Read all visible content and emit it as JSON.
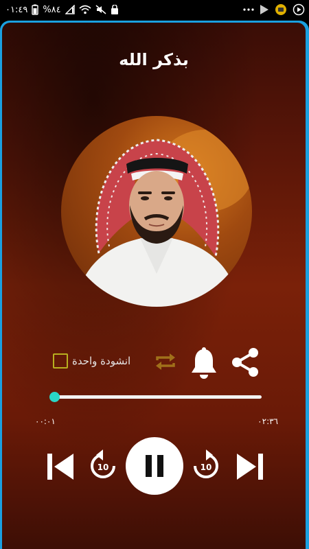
{
  "status_bar": {
    "time": "٠١:٤٩",
    "battery": "%٨٤"
  },
  "track": {
    "title": "بذكر الله"
  },
  "options": {
    "single_label": "انشودة واحدة",
    "single_checked": false
  },
  "progress": {
    "fraction": 0.01,
    "current_time": "٠٠:٠١",
    "total_time": "٠٢:٣٦"
  },
  "colors": {
    "accent": "#2ad6c6",
    "frame": "#1aa0e0",
    "checkbox": "#b8b020",
    "repeat_icon": "#a0701a"
  },
  "icons": {
    "share": "share-icon",
    "bell": "bell-icon",
    "repeat": "repeat-icon",
    "previous": "skip-previous-icon",
    "rewind": "replay-10-icon",
    "pause": "pause-icon",
    "forward": "forward-10-icon",
    "next": "skip-next-icon"
  },
  "skip_seconds": "10"
}
